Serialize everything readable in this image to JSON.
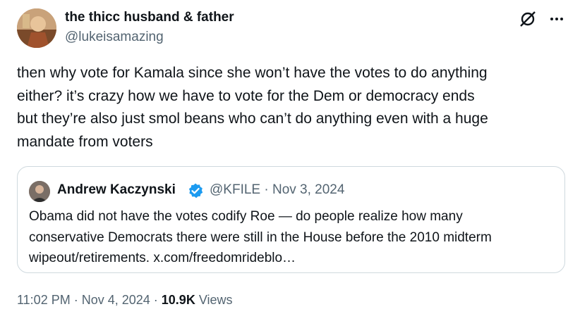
{
  "author": {
    "display_name": "the thicc husband & father",
    "handle": "@lukeisamazing"
  },
  "icons": {
    "grok": "grok-icon",
    "more": "more-icon",
    "verified": "verified-badge-icon"
  },
  "tweet": {
    "lines": [
      "then why vote for Kamala since she won’t have the votes to do anything",
      "either? it’s crazy how we have to vote for the Dem or democracy ends",
      "but they’re also just smol beans who can’t do anything even with a huge",
      "mandate from voters"
    ]
  },
  "quote": {
    "name": "Andrew Kaczynski",
    "meta": "@KFILE · Nov 3, 2024",
    "lines": [
      "Obama did not have the votes codify Roe — do people realize how many",
      "conservative Democrats there were still in the House before the 2010 midterm",
      "wipeout/retirements. x.com/freedomrideblo…"
    ]
  },
  "footer": {
    "time": "11:02 PM · Nov 4, 2024",
    "separator": " · ",
    "views_count": "10.9K",
    "views_label": " Views"
  },
  "colors": {
    "text": "#0f1419",
    "secondary": "#536471",
    "verified": "#1d9bf0",
    "border": "#cfd9de"
  }
}
